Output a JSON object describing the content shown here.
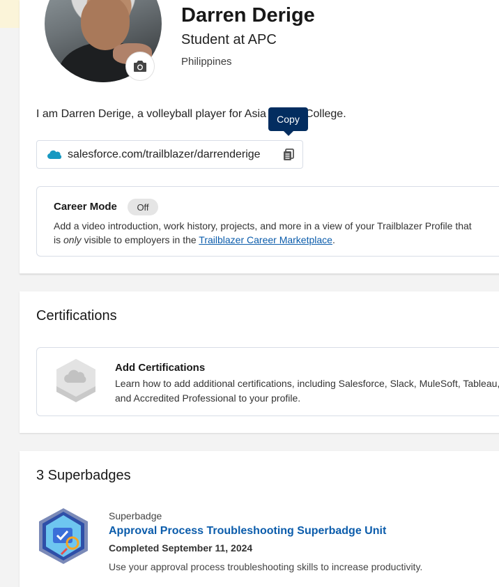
{
  "profile": {
    "name": "Darren Derige",
    "headline": "Student at APC",
    "location": "Philippines",
    "bio": "I am Darren Derige, a volleyball player for Asia Pacific College.",
    "url": "salesforce.com/trailblazer/darrenderige",
    "copy_tooltip": "Copy",
    "camera_icon": "camera-icon",
    "cloud_icon": "salesforce-cloud-icon"
  },
  "career": {
    "title": "Career Mode",
    "toggle_label": "Off",
    "desc_part1": "Add a video introduction, work history, projects, and more in a view of your Trailblazer Profile that",
    "desc_part2_prefix": "is ",
    "desc_part2_emph": "only",
    "desc_part2_mid": " visible to employers in the ",
    "desc_link": "Trailblazer Career Marketplace",
    "desc_part2_suffix": "."
  },
  "certifications": {
    "section_title": "Certifications",
    "add_title": "Add Certifications",
    "add_desc": "Learn how to add additional certifications, including Salesforce, Slack, MuleSoft, Tableau, and Accredited Professional to your profile."
  },
  "superbadges": {
    "section_title": "3 Superbadges",
    "items": [
      {
        "type": "Superbadge",
        "title": "Approval Process Troubleshooting Superbadge Unit",
        "completed": "Completed September 11, 2024",
        "desc": "Use your approval process troubleshooting skills to increase productivity."
      }
    ]
  },
  "colors": {
    "link": "#0b5cab",
    "tooltip_bg": "#032d60",
    "background": "#f3f3f3"
  }
}
